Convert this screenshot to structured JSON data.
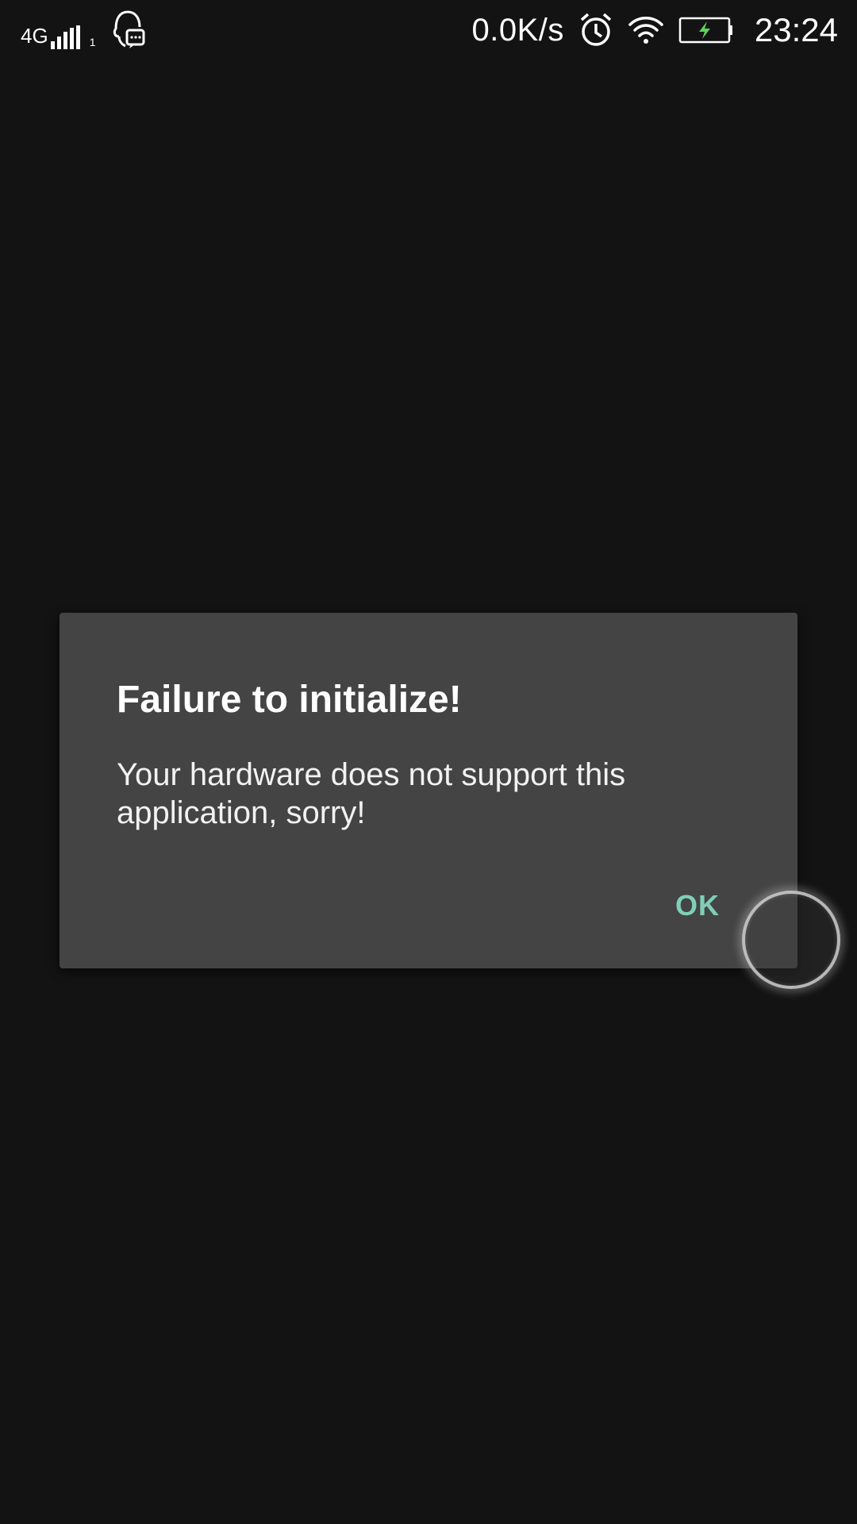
{
  "status_bar": {
    "network_type": "4G",
    "sim_slot": "1",
    "chat_icon": "qq-chat-icon",
    "speed": "0.0K/s",
    "alarm_icon": "alarm-clock-icon",
    "wifi_icon": "wifi-icon",
    "battery_icon": "battery-charging-icon",
    "time": "23:24"
  },
  "dialog": {
    "title": "Failure to initialize!",
    "message": "Your hardware does not support this application, sorry!",
    "ok_label": "OK"
  },
  "colors": {
    "background": "#131313",
    "dialog_background": "#444444",
    "accent": "#7fcfb8",
    "battery_bolt": "#5fd35f"
  }
}
